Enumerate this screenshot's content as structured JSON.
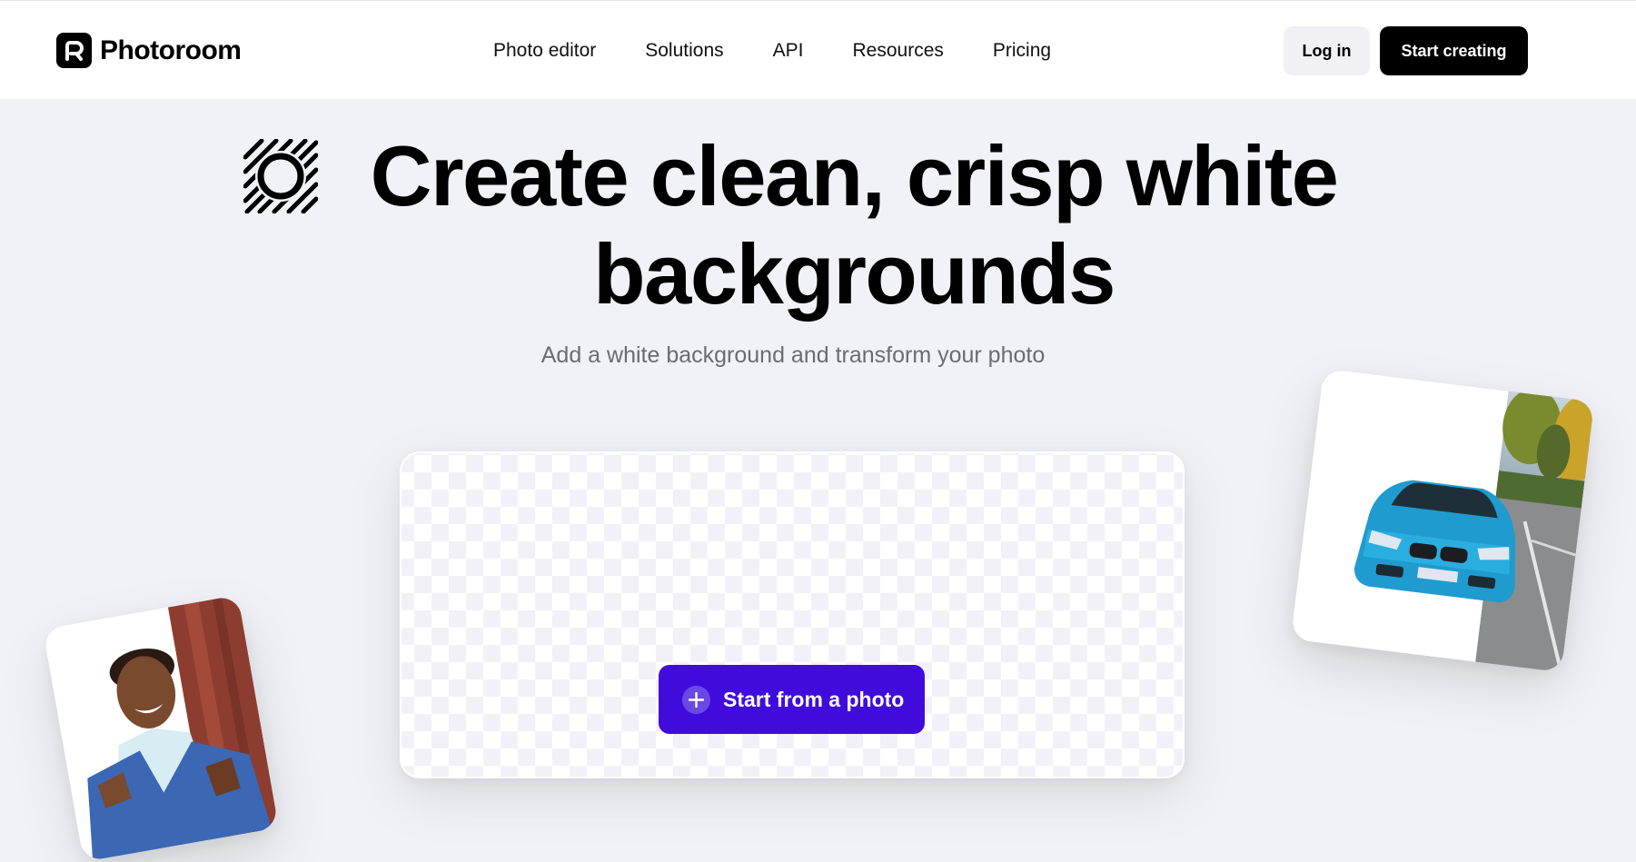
{
  "header": {
    "brand": "Photoroom",
    "logo_icon": "photoroom-logo-icon",
    "nav": [
      {
        "label": "Photo editor"
      },
      {
        "label": "Solutions"
      },
      {
        "label": "API"
      },
      {
        "label": "Resources"
      },
      {
        "label": "Pricing"
      }
    ],
    "login_label": "Log in",
    "start_label": "Start creating"
  },
  "hero": {
    "icon": "white-background-icon",
    "title_line1": "Create clean, crisp white",
    "title_line2": "backgrounds",
    "subtitle": "Add a white background and transform your photo"
  },
  "upload": {
    "button_label": "Start from a photo",
    "button_icon": "plus-icon"
  },
  "examples": {
    "car_card": "car-before-after-example",
    "portrait_card": "portrait-before-after-example"
  },
  "colors": {
    "page_bg": "#f1f2f7",
    "accent": "#400cdb",
    "text_muted": "#6b6c72"
  }
}
